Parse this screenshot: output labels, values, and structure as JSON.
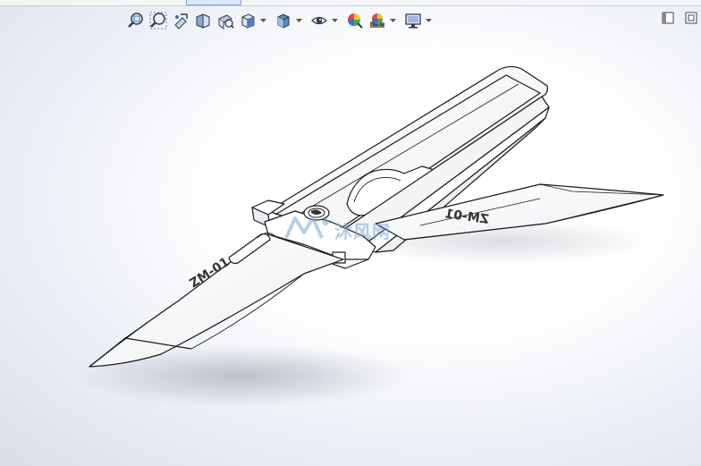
{
  "toolbar": {
    "name": "heads-up-view-toolbar",
    "buttons": [
      {
        "id": "zoom-to-fit",
        "icon": "zoom-to-fit-icon",
        "has_dropdown": false
      },
      {
        "id": "zoom-to-area",
        "icon": "zoom-to-area-icon",
        "has_dropdown": false
      },
      {
        "id": "previous-view",
        "icon": "previous-view-icon",
        "has_dropdown": false
      },
      {
        "id": "section-view",
        "icon": "section-view-icon",
        "has_dropdown": false
      },
      {
        "id": "dynamic-annotation-views",
        "icon": "dynamic-annotation-icon",
        "has_dropdown": false
      },
      {
        "id": "view-orientation",
        "icon": "view-orientation-icon",
        "has_dropdown": true
      },
      {
        "id": "display-style",
        "icon": "display-style-icon",
        "has_dropdown": true
      },
      {
        "id": "hide-show-items",
        "icon": "hide-show-items-icon",
        "has_dropdown": true
      },
      {
        "id": "edit-appearance",
        "icon": "edit-appearance-icon",
        "has_dropdown": false
      },
      {
        "id": "apply-scene",
        "icon": "apply-scene-icon",
        "has_dropdown": true
      },
      {
        "id": "view-settings",
        "icon": "view-settings-icon",
        "has_dropdown": true
      }
    ]
  },
  "window_controls": [
    {
      "id": "panel-toggle",
      "icon": "panel-toggle-icon"
    },
    {
      "id": "restore-view",
      "icon": "restore-view-icon"
    }
  ],
  "model": {
    "engravings": {
      "left_blade": "ZM-01",
      "right_blade": "ZM-01"
    }
  },
  "watermark": {
    "text": "沐风网",
    "logo_icon": "mufeng-logo-icon"
  },
  "colors": {
    "background_center": "#ffffff",
    "background_edge": "#d9dee9",
    "model_stroke": "#1a1a1a",
    "model_fill": "#ffffff",
    "watermark": "#7fa6d4"
  }
}
